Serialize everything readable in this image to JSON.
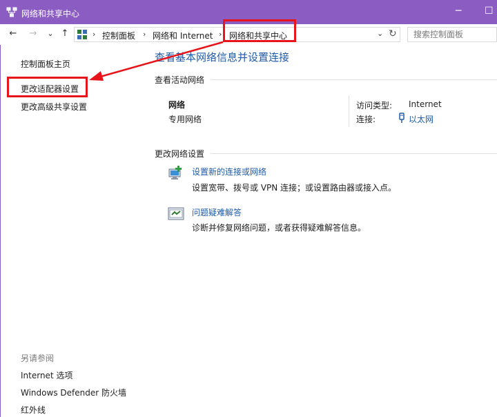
{
  "window": {
    "title": "网络和共享中心",
    "minimize": "─",
    "maximize": "☐"
  },
  "nav": {
    "back": "←",
    "forward": "→",
    "recent": "⌄",
    "up": "↑"
  },
  "address": {
    "crumbs": [
      "控制面板",
      "网络和 Internet",
      "网络和共享中心"
    ],
    "separator": "›",
    "dropdown": "⌄",
    "refresh": "↻"
  },
  "search": {
    "placeholder": "搜索控制面板"
  },
  "sidebar": {
    "items": [
      {
        "label": "控制面板主页"
      },
      {
        "label": "更改适配器设置"
      },
      {
        "label": "更改高级共享设置"
      }
    ],
    "see_also_title": "另请参阅",
    "see_also": [
      {
        "label": "Internet 选项"
      },
      {
        "label": "Windows Defender 防火墙"
      },
      {
        "label": "红外线"
      }
    ]
  },
  "main": {
    "title": "查看基本网络信息并设置连接",
    "active_networks_header": "查看活动网络",
    "network": {
      "name": "网络",
      "type": "专用网络",
      "access_type_label": "访问类型:",
      "access_type_value": "Internet",
      "connection_label": "连接:",
      "connection_value": "以太网"
    },
    "change_settings_header": "更改网络设置",
    "tasks": [
      {
        "link": "设置新的连接或网络",
        "desc": "设置宽带、拨号或 VPN 连接；或设置路由器或接入点。",
        "icon": "new-connection-icon"
      },
      {
        "link": "问题疑难解答",
        "desc": "诊断并修复网络问题，或者获得疑难解答信息。",
        "icon": "troubleshoot-icon"
      }
    ]
  },
  "colors": {
    "titlebar": "#8b5cc2",
    "link": "#1f5aa8",
    "annotation": "#e8141b"
  }
}
